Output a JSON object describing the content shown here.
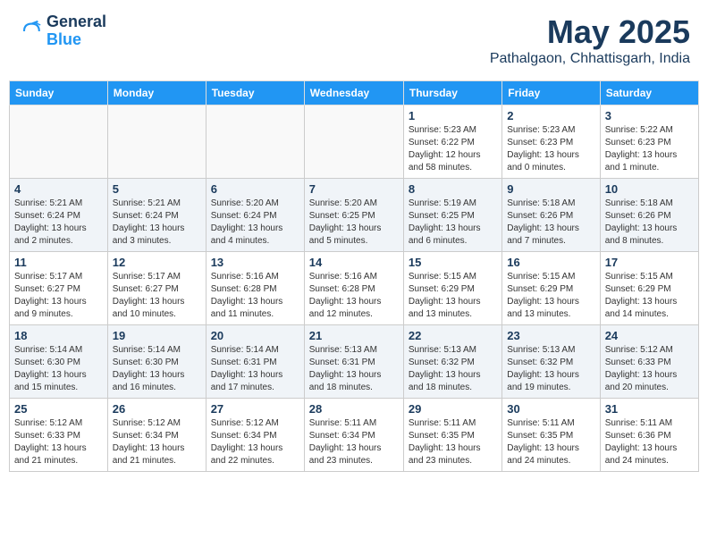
{
  "header": {
    "logo_line1": "General",
    "logo_line2": "Blue",
    "month": "May 2025",
    "location": "Pathalgaon, Chhattisgarh, India"
  },
  "weekdays": [
    "Sunday",
    "Monday",
    "Tuesday",
    "Wednesday",
    "Thursday",
    "Friday",
    "Saturday"
  ],
  "weeks": [
    [
      {
        "day": "",
        "info": ""
      },
      {
        "day": "",
        "info": ""
      },
      {
        "day": "",
        "info": ""
      },
      {
        "day": "",
        "info": ""
      },
      {
        "day": "1",
        "info": "Sunrise: 5:23 AM\nSunset: 6:22 PM\nDaylight: 12 hours\nand 58 minutes."
      },
      {
        "day": "2",
        "info": "Sunrise: 5:23 AM\nSunset: 6:23 PM\nDaylight: 13 hours\nand 0 minutes."
      },
      {
        "day": "3",
        "info": "Sunrise: 5:22 AM\nSunset: 6:23 PM\nDaylight: 13 hours\nand 1 minute."
      }
    ],
    [
      {
        "day": "4",
        "info": "Sunrise: 5:21 AM\nSunset: 6:24 PM\nDaylight: 13 hours\nand 2 minutes."
      },
      {
        "day": "5",
        "info": "Sunrise: 5:21 AM\nSunset: 6:24 PM\nDaylight: 13 hours\nand 3 minutes."
      },
      {
        "day": "6",
        "info": "Sunrise: 5:20 AM\nSunset: 6:24 PM\nDaylight: 13 hours\nand 4 minutes."
      },
      {
        "day": "7",
        "info": "Sunrise: 5:20 AM\nSunset: 6:25 PM\nDaylight: 13 hours\nand 5 minutes."
      },
      {
        "day": "8",
        "info": "Sunrise: 5:19 AM\nSunset: 6:25 PM\nDaylight: 13 hours\nand 6 minutes."
      },
      {
        "day": "9",
        "info": "Sunrise: 5:18 AM\nSunset: 6:26 PM\nDaylight: 13 hours\nand 7 minutes."
      },
      {
        "day": "10",
        "info": "Sunrise: 5:18 AM\nSunset: 6:26 PM\nDaylight: 13 hours\nand 8 minutes."
      }
    ],
    [
      {
        "day": "11",
        "info": "Sunrise: 5:17 AM\nSunset: 6:27 PM\nDaylight: 13 hours\nand 9 minutes."
      },
      {
        "day": "12",
        "info": "Sunrise: 5:17 AM\nSunset: 6:27 PM\nDaylight: 13 hours\nand 10 minutes."
      },
      {
        "day": "13",
        "info": "Sunrise: 5:16 AM\nSunset: 6:28 PM\nDaylight: 13 hours\nand 11 minutes."
      },
      {
        "day": "14",
        "info": "Sunrise: 5:16 AM\nSunset: 6:28 PM\nDaylight: 13 hours\nand 12 minutes."
      },
      {
        "day": "15",
        "info": "Sunrise: 5:15 AM\nSunset: 6:29 PM\nDaylight: 13 hours\nand 13 minutes."
      },
      {
        "day": "16",
        "info": "Sunrise: 5:15 AM\nSunset: 6:29 PM\nDaylight: 13 hours\nand 13 minutes."
      },
      {
        "day": "17",
        "info": "Sunrise: 5:15 AM\nSunset: 6:29 PM\nDaylight: 13 hours\nand 14 minutes."
      }
    ],
    [
      {
        "day": "18",
        "info": "Sunrise: 5:14 AM\nSunset: 6:30 PM\nDaylight: 13 hours\nand 15 minutes."
      },
      {
        "day": "19",
        "info": "Sunrise: 5:14 AM\nSunset: 6:30 PM\nDaylight: 13 hours\nand 16 minutes."
      },
      {
        "day": "20",
        "info": "Sunrise: 5:14 AM\nSunset: 6:31 PM\nDaylight: 13 hours\nand 17 minutes."
      },
      {
        "day": "21",
        "info": "Sunrise: 5:13 AM\nSunset: 6:31 PM\nDaylight: 13 hours\nand 18 minutes."
      },
      {
        "day": "22",
        "info": "Sunrise: 5:13 AM\nSunset: 6:32 PM\nDaylight: 13 hours\nand 18 minutes."
      },
      {
        "day": "23",
        "info": "Sunrise: 5:13 AM\nSunset: 6:32 PM\nDaylight: 13 hours\nand 19 minutes."
      },
      {
        "day": "24",
        "info": "Sunrise: 5:12 AM\nSunset: 6:33 PM\nDaylight: 13 hours\nand 20 minutes."
      }
    ],
    [
      {
        "day": "25",
        "info": "Sunrise: 5:12 AM\nSunset: 6:33 PM\nDaylight: 13 hours\nand 21 minutes."
      },
      {
        "day": "26",
        "info": "Sunrise: 5:12 AM\nSunset: 6:34 PM\nDaylight: 13 hours\nand 21 minutes."
      },
      {
        "day": "27",
        "info": "Sunrise: 5:12 AM\nSunset: 6:34 PM\nDaylight: 13 hours\nand 22 minutes."
      },
      {
        "day": "28",
        "info": "Sunrise: 5:11 AM\nSunset: 6:34 PM\nDaylight: 13 hours\nand 23 minutes."
      },
      {
        "day": "29",
        "info": "Sunrise: 5:11 AM\nSunset: 6:35 PM\nDaylight: 13 hours\nand 23 minutes."
      },
      {
        "day": "30",
        "info": "Sunrise: 5:11 AM\nSunset: 6:35 PM\nDaylight: 13 hours\nand 24 minutes."
      },
      {
        "day": "31",
        "info": "Sunrise: 5:11 AM\nSunset: 6:36 PM\nDaylight: 13 hours\nand 24 minutes."
      }
    ]
  ]
}
